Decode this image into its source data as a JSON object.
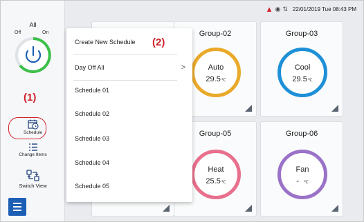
{
  "status_bar": {
    "datetime": "22/01/2019 Tue 08:43 PM"
  },
  "sidebar": {
    "all_label": "All",
    "off_label": "Off",
    "on_label": "On",
    "schedule_label": "Schedule",
    "change_items_label": "Change Items",
    "switch_view_label": "Switch View"
  },
  "annotations": {
    "one": "(1)",
    "two": "(2)"
  },
  "menu": {
    "create_new": "Create New Schedule",
    "day_off_all": "Day Off All",
    "chevron": ">",
    "items": [
      "Schedule 01",
      "Schedule 02",
      "Schedule 03",
      "Schedule 04",
      "Schedule 05"
    ]
  },
  "groups": [
    {
      "name": "Group-02",
      "mode": "Auto",
      "temp": "29.5",
      "unit": "℃",
      "color": "#e9a92a"
    },
    {
      "name": "Group-03",
      "mode": "Cool",
      "temp": "29.5",
      "unit": "℃",
      "color": "#1e90d8"
    },
    {
      "name": "Group-05",
      "mode": "Heat",
      "temp": "25.5",
      "unit": "℃",
      "color": "#e8708d"
    },
    {
      "name": "Group-06",
      "mode": "Fan",
      "temp": "-",
      "unit": "℃",
      "color": "#9a72c8"
    }
  ],
  "colors": {
    "power_on": "#3cc04a",
    "accent_blue": "#1d5fb5",
    "annotation_red": "#d0202a"
  }
}
